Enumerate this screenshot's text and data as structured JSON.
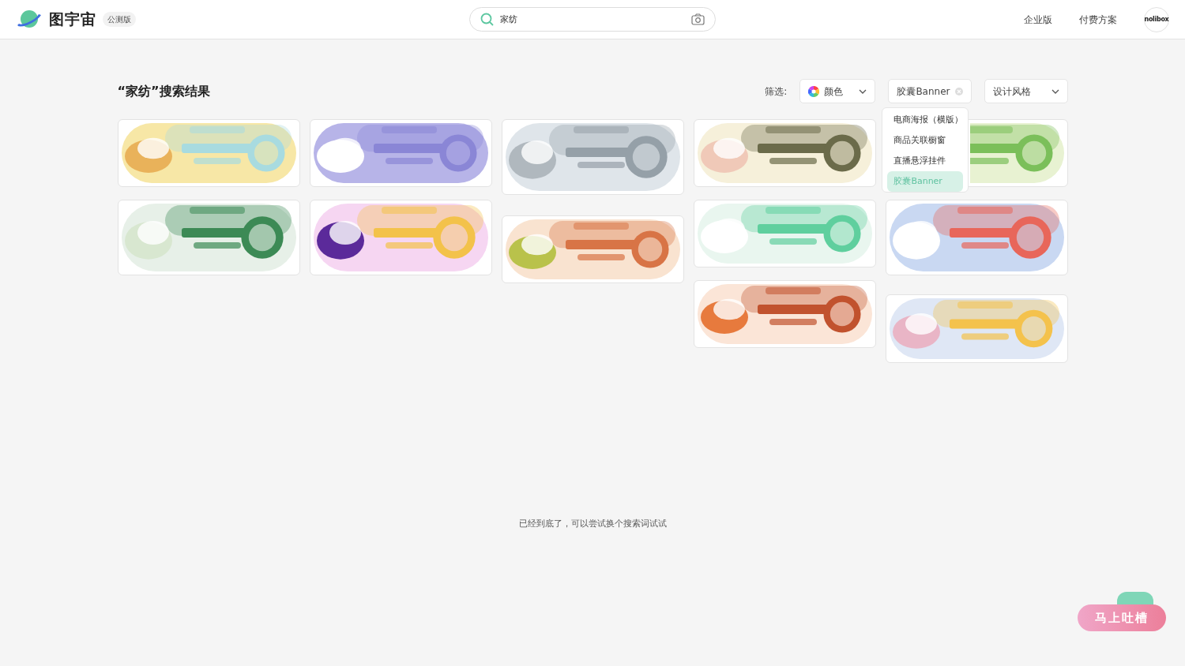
{
  "header": {
    "logo_text": "图宇宙",
    "beta_badge": "公测版",
    "search": {
      "value": "家纺"
    },
    "nav": [
      {
        "label": "企业版"
      },
      {
        "label": "付费方案"
      }
    ],
    "avatar_text": "nolibox"
  },
  "results_title": "“家纺”搜索结果",
  "filters": {
    "label": "筛选:",
    "items": [
      {
        "kind": "color",
        "label": "颜色"
      },
      {
        "kind": "active",
        "label": "胶囊Banner"
      },
      {
        "kind": "select",
        "label": "设计风格"
      }
    ],
    "dropdown": [
      {
        "label": "电商海报（横版）",
        "selected": false
      },
      {
        "label": "商品关联橱窗",
        "selected": false
      },
      {
        "label": "直播悬浮挂件",
        "selected": false
      },
      {
        "label": "胶囊Banner",
        "selected": true
      }
    ]
  },
  "end_message": "已经到底了，可以尝试换个搜索词试试",
  "feedback_button": "马上吐槽"
}
